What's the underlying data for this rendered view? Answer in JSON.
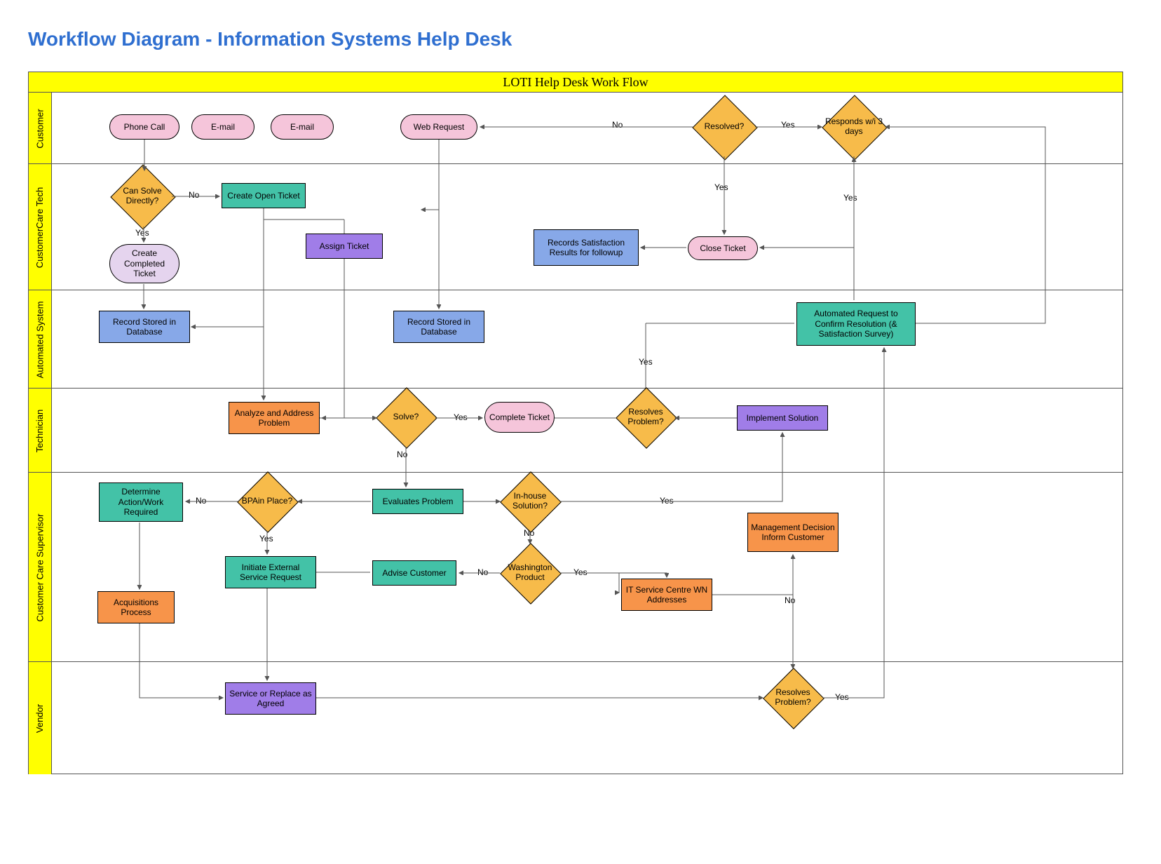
{
  "title": "Workflow Diagram - Information Systems Help Desk",
  "swimlane_title": "LOTI Help Desk Work Flow",
  "lanes": {
    "customer": "Customer",
    "cc_tech": "CustomerCare Tech",
    "automated": "Automated System",
    "technician": "Technician",
    "supervisor": "Customer Care Supervisor",
    "vendor": "Vendor"
  },
  "nodes": {
    "phone_call": "Phone Call",
    "email1": "E-mail",
    "email2": "E-mail",
    "web_request": "Web Request",
    "can_solve": "Can  Solve Directly?",
    "create_open": "Create Open Ticket",
    "create_completed": "Create Completed Ticket",
    "assign_ticket": "Assign Ticket",
    "resolved": "Resolved?",
    "responds": "Responds w/i 3 days",
    "close_ticket": "Close Ticket",
    "records_satisfaction": "Records Satisfaction Results for followup",
    "record_stored1": "Record Stored in Database",
    "record_stored2": "Record Stored in Database",
    "automated_request": "Automated Request to Confirm Resolution (& Satisfaction Survey)",
    "analyze": "Analyze and Address Problem",
    "solve": "Solve?",
    "complete_ticket": "Complete Ticket",
    "resolves_problem": "Resolves Problem?",
    "implement_solution": "Implement Solution",
    "determine_action": "Determine Action/Work Required",
    "bpa_in_place": "BPAin Place?",
    "evaluates_problem": "Evaluates Problem",
    "in_house": "In-house Solution?",
    "initiate_external": "Initiate External Service Request",
    "advise_customer": "Advise Customer",
    "washington_product": "Washington Product",
    "it_service_centre": "IT Service Centre WN Addresses",
    "management_decision": "Management Decision Inform Customer",
    "acquisitions": "Acquisitions Process",
    "service_replace": "Service or Replace as Agreed",
    "resolves_problem2": "Resolves Problem?"
  },
  "labels": {
    "yes": "Yes",
    "no": "No"
  }
}
